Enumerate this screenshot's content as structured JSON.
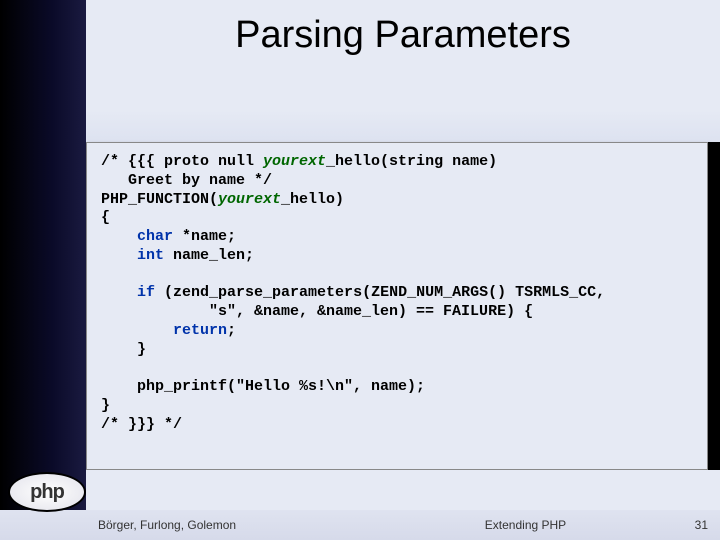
{
  "title": "Parsing Parameters",
  "code": {
    "l1a": "/* {{{ proto null ",
    "l1b": "yourext",
    "l1c": "_hello(string name)",
    "l2": "   Greet by name */",
    "l3a": "PHP_FUNCTION(",
    "l3b": "yourext",
    "l3c": "_hello)",
    "l4": "{",
    "l5a": "    ",
    "l5b": "char",
    "l5c": " *name;",
    "l6a": "    ",
    "l6b": "int",
    "l6c": " name_len;",
    "blank1": " ",
    "l7a": "    ",
    "l7b": "if",
    "l7c": " (zend_parse_parameters(ZEND_NUM_ARGS() TSRMLS_CC,",
    "l8": "            \"s\", &name, &name_len) == FAILURE) {",
    "l9a": "        ",
    "l9b": "return",
    "l9c": ";",
    "l10": "    }",
    "blank2": " ",
    "l11": "    php_printf(\"Hello %s!\\n\", name);",
    "l12": "}",
    "l13": "/* }}} */"
  },
  "logo_text": "php",
  "footer": {
    "authors": "Börger, Furlong, Golemon",
    "subject": "Extending PHP",
    "page": "31"
  }
}
